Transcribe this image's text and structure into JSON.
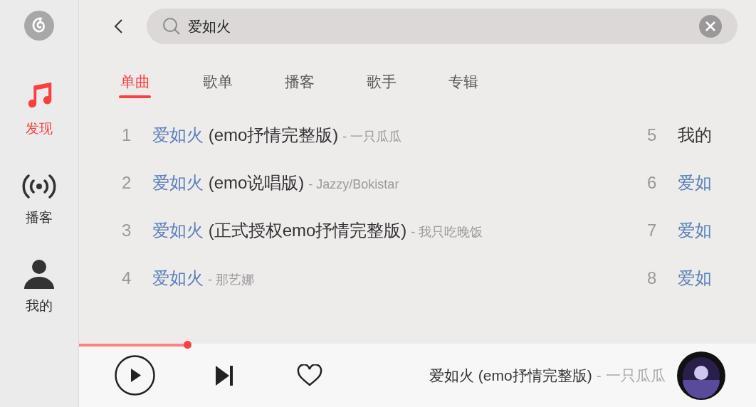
{
  "sidebar": {
    "items": [
      {
        "label": "发现",
        "selected": true,
        "kind": "music"
      },
      {
        "label": "播客",
        "selected": false,
        "kind": "podcast"
      },
      {
        "label": "我的",
        "selected": false,
        "kind": "user"
      }
    ]
  },
  "search": {
    "value": "爱如火"
  },
  "tabs": [
    {
      "label": "单曲",
      "selected": true
    },
    {
      "label": "歌单",
      "selected": false
    },
    {
      "label": "播客",
      "selected": false
    },
    {
      "label": "歌手",
      "selected": false
    },
    {
      "label": "专辑",
      "selected": false
    }
  ],
  "songs": [
    {
      "index": "1",
      "match": "爱如火",
      "title": " (emo抒情完整版)",
      "artist": "- 一只瓜瓜"
    },
    {
      "index": "2",
      "match": "爱如火",
      "title": " (emo说唱版)",
      "artist": "- Jazzy/Bokistar"
    },
    {
      "index": "3",
      "match": "爱如火",
      "title": " (正式授权emo抒情完整版)",
      "artist": "- 我只吃晚饭"
    },
    {
      "index": "4",
      "match": "爱如火",
      "artist": "- 那艺娜"
    },
    {
      "index": "5",
      "title": "我的"
    },
    {
      "index": "6",
      "match": "爱如"
    },
    {
      "index": "7",
      "match": "爱如"
    },
    {
      "index": "8",
      "match": "爱如"
    }
  ],
  "player": {
    "level": 0.16,
    "title": "爱如火 (emo抒情完整版)",
    "artist": "- 一只瓜瓜",
    "playing": false,
    "liked": false
  }
}
